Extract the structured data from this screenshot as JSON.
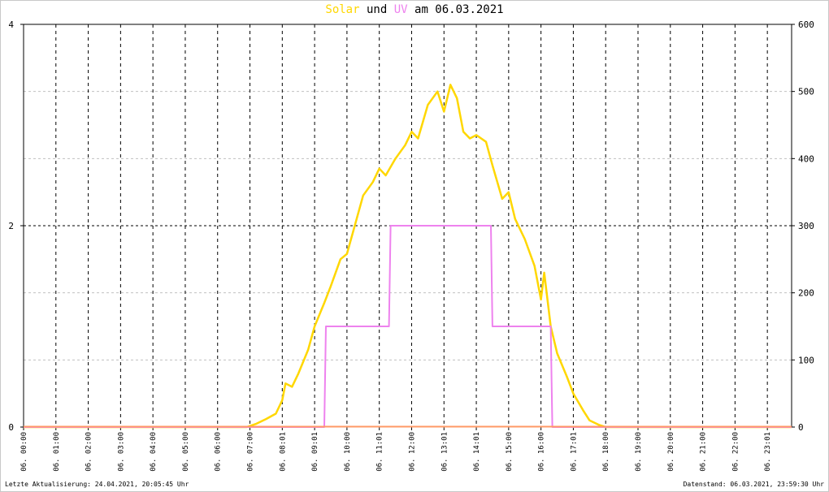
{
  "title": {
    "solar": "Solar",
    "und": "und",
    "uv": "UV",
    "rest": "am 06.03.2021"
  },
  "footer": {
    "left": "Letzte Aktualisierung: 24.04.2021, 20:05:45 Uhr",
    "right": "Datenstand: 06.03.2021, 23:59:30 Uhr"
  },
  "colors": {
    "solar": "#ffd700",
    "uv": "#ee82ee",
    "baseline": "#ff9966",
    "grid_major": "#000000",
    "grid_minor": "#c0c0c0"
  },
  "chart_data": {
    "type": "line",
    "x_unit": "hour",
    "xlim": [
      0,
      23.75
    ],
    "x_tick_labels": [
      "06. 00:00",
      "06. 01:00",
      "06. 02:00",
      "06. 03:00",
      "06. 04:00",
      "06. 05:00",
      "06. 06:00",
      "06. 07:00",
      "06. 08:01",
      "06. 09:01",
      "06. 10:00",
      "06. 11:01",
      "06. 12:00",
      "06. 13:01",
      "06. 14:01",
      "06. 15:00",
      "06. 16:00",
      "06. 17:01",
      "06. 18:00",
      "06. 19:00",
      "06. 20:00",
      "06. 21:00",
      "06. 22:00",
      "06. 23:01"
    ],
    "y_left": {
      "lim": [
        0,
        4
      ],
      "ticks": [
        "0",
        "2",
        "4"
      ]
    },
    "y_right": {
      "lim": [
        0,
        600
      ],
      "ticks": [
        "0",
        "100",
        "200",
        "300",
        "400",
        "500",
        "600"
      ]
    },
    "grid": true,
    "series": [
      {
        "name": "Solar",
        "axis": "right",
        "x": [
          0,
          6.9,
          7.2,
          7.5,
          7.8,
          8.0,
          8.1,
          8.3,
          8.5,
          8.8,
          9.0,
          9.3,
          9.5,
          9.8,
          10.0,
          10.3,
          10.5,
          10.8,
          11.0,
          11.2,
          11.5,
          11.8,
          12.0,
          12.2,
          12.5,
          12.8,
          13.0,
          13.2,
          13.4,
          13.6,
          13.8,
          14.0,
          14.3,
          14.5,
          14.8,
          15.0,
          15.2,
          15.5,
          15.8,
          16.0,
          16.1,
          16.3,
          16.5,
          16.8,
          17.0,
          17.3,
          17.5,
          17.8,
          18.0,
          18.2,
          18.3,
          23.75
        ],
        "values": [
          0,
          0,
          5,
          12,
          20,
          40,
          65,
          60,
          80,
          115,
          150,
          185,
          210,
          250,
          258,
          310,
          345,
          365,
          385,
          375,
          400,
          420,
          440,
          430,
          480,
          500,
          470,
          510,
          490,
          440,
          430,
          435,
          425,
          390,
          340,
          350,
          310,
          280,
          240,
          190,
          230,
          150,
          110,
          75,
          50,
          25,
          10,
          3,
          0,
          0,
          0,
          0
        ]
      },
      {
        "name": "UV",
        "axis": "left",
        "x": [
          0,
          9.3,
          9.35,
          11.3,
          11.35,
          14.45,
          14.5,
          16.3,
          16.35,
          18.1,
          23.75
        ],
        "values": [
          0,
          0,
          1,
          1,
          2,
          2,
          1,
          1,
          0,
          0,
          0
        ]
      }
    ]
  }
}
